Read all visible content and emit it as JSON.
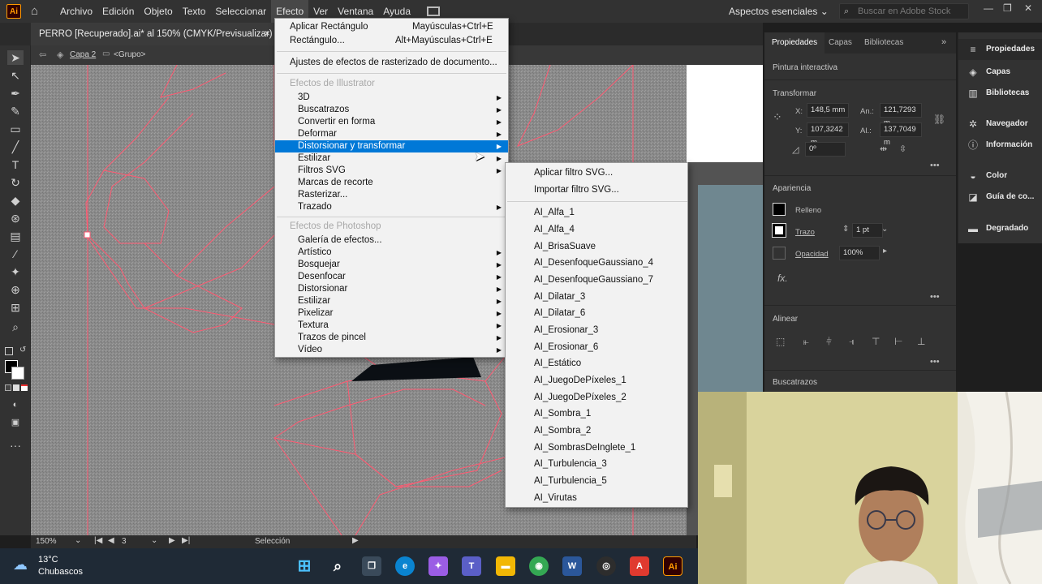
{
  "app": {
    "logo": "Ai",
    "menu": [
      "Archivo",
      "Edición",
      "Objeto",
      "Texto",
      "Seleccionar",
      "Efecto",
      "Ver",
      "Ventana",
      "Ayuda"
    ],
    "active_menu": "Efecto",
    "workspace": "Aspectos esenciales",
    "search_placeholder": "Buscar en Adobe Stock"
  },
  "document": {
    "tab_title": "PERRO [Recuperado].ai* al 150% (CMYK/Previsualizar)",
    "close": "×",
    "breadcrumb": [
      "Capa 2",
      "<Grupo>"
    ]
  },
  "effect_menu": {
    "items": [
      {
        "label": "Aplicar Rectángulo",
        "shortcut": "Mayúsculas+Ctrl+E"
      },
      {
        "label": "Rectángulo...",
        "shortcut": "Alt+Mayúsculas+Ctrl+E"
      },
      {
        "label": "Ajustes de efectos de rasterizado de documento..."
      }
    ],
    "illustrator_header": "Efectos de Illustrator",
    "illustrator_items": [
      {
        "label": "3D",
        "sub": true
      },
      {
        "label": "Buscatrazos",
        "sub": true
      },
      {
        "label": "Convertir en forma",
        "sub": true
      },
      {
        "label": "Deformar",
        "sub": true
      },
      {
        "label": "Distorsionar y transformar",
        "sub": true,
        "highlight": true
      },
      {
        "label": "Estilizar",
        "sub": true
      },
      {
        "label": "Filtros SVG",
        "sub": true
      },
      {
        "label": "Marcas de recorte",
        "sub": false
      },
      {
        "label": "Rasterizar...",
        "sub": false
      },
      {
        "label": "Trazado",
        "sub": true
      }
    ],
    "photoshop_header": "Efectos de Photoshop",
    "photoshop_items": [
      {
        "label": "Galería de efectos...",
        "sub": false
      },
      {
        "label": "Artístico",
        "sub": true
      },
      {
        "label": "Bosquejar",
        "sub": true
      },
      {
        "label": "Desenfocar",
        "sub": true
      },
      {
        "label": "Distorsionar",
        "sub": true
      },
      {
        "label": "Estilizar",
        "sub": true
      },
      {
        "label": "Pixelizar",
        "sub": true
      },
      {
        "label": "Textura",
        "sub": true
      },
      {
        "label": "Trazos de pincel",
        "sub": true
      },
      {
        "label": "Vídeo",
        "sub": true
      }
    ]
  },
  "svg_menu": {
    "top": [
      "Aplicar filtro SVG...",
      "Importar filtro SVG..."
    ],
    "filters": [
      "AI_Alfa_1",
      "AI_Alfa_4",
      "AI_BrisaSuave",
      "AI_DesenfoqueGaussiano_4",
      "AI_DesenfoqueGaussiano_7",
      "AI_Dilatar_3",
      "AI_Dilatar_6",
      "AI_Erosionar_3",
      "AI_Erosionar_6",
      "AI_Estático",
      "AI_JuegoDePíxeles_1",
      "AI_JuegoDePíxeles_2",
      "AI_Sombra_1",
      "AI_Sombra_2",
      "AI_SombrasDeInglete_1",
      "AI_Turbulencia_3",
      "AI_Turbulencia_5",
      "AI_Virutas"
    ]
  },
  "properties_panel": {
    "tabs": [
      "Propiedades",
      "Capas",
      "Bibliotecas"
    ],
    "heading": "Pintura interactiva",
    "transform": {
      "title": "Transformar",
      "x_label": "X:",
      "x": "148,5 mm",
      "y_label": "Y:",
      "y": "107,3242 m",
      "w_label": "An.:",
      "w": "121,7293 m",
      "h_label": "Al.:",
      "h": "137,7049 m",
      "angle": "0º"
    },
    "appearance": {
      "title": "Apariencia",
      "fill": "Relleno",
      "stroke": "Trazo",
      "stroke_weight": "1 pt",
      "opacity_label": "Opacidad",
      "opacity": "100%",
      "fx": "fx."
    },
    "align_title": "Alinear",
    "trace_title": "Buscatrazos"
  },
  "dock": [
    "Propiedades",
    "Capas",
    "Bibliotecas",
    "Navegador",
    "Información",
    "Color",
    "Guía de co...",
    "Degradado"
  ],
  "status": {
    "zoom": "150%",
    "artboard": "3",
    "tool": "Selección"
  },
  "taskbar": {
    "temperature": "13°C",
    "weather": "Chubascos"
  },
  "colors": {
    "menu_highlight": "#0078d7",
    "path_stroke": "#ff4d6a",
    "app_bg": "#323232"
  }
}
